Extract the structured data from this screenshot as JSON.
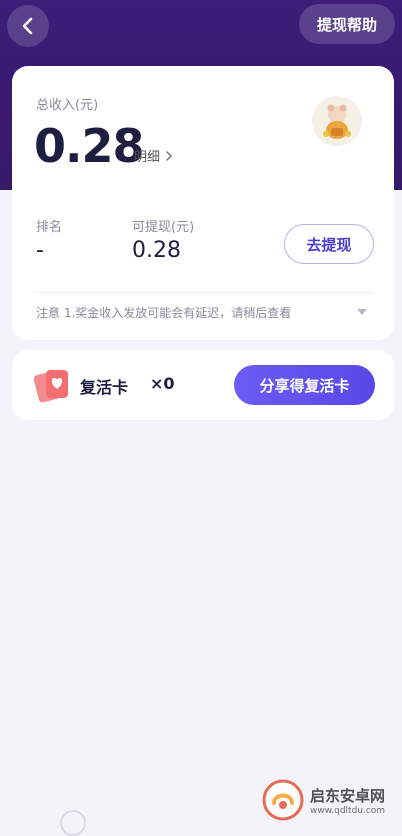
{
  "header": {
    "help_label": "提现帮助"
  },
  "summary": {
    "total_label": "总收入(元)",
    "total_amount": "0.28",
    "detail_label": "明细"
  },
  "stats": {
    "rank_label": "排名",
    "rank_value": "-",
    "available_label": "可提现(元)",
    "available_value": "0.28",
    "withdraw_label": "去提现"
  },
  "notice": {
    "text": "注意 1.奖金收入发放可能会有延迟，请稍后查看"
  },
  "revive": {
    "title": "复活卡",
    "count": "×0",
    "share_label": "分享得复活卡"
  },
  "watermark": {
    "name": "启东安卓网",
    "url": "www.qdltdu.com"
  },
  "colors": {
    "header": "#3d1d78",
    "accent": "#5a47e8",
    "text": "#1e1f40"
  }
}
